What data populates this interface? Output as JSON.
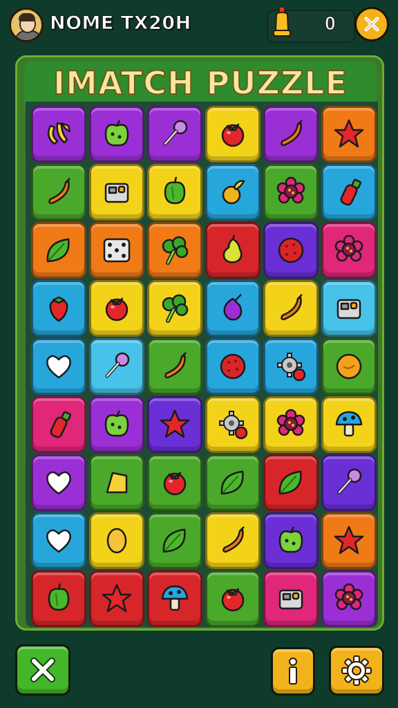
{
  "player": {
    "name": "NOME TX20H"
  },
  "score": {
    "value": "0"
  },
  "title": "IMATCH PUZZLE",
  "colors": {
    "purple": "#9b2fd6",
    "green": "#4aa82a",
    "yellow": "#f3d21a",
    "orange": "#f07a16",
    "red": "#d7262a",
    "blue": "#27a6dc",
    "pink": "#e0277a",
    "violet": "#6b2fd6",
    "lightblue": "#47c2e8"
  },
  "grid": [
    [
      {
        "c": "purple",
        "i": "banana-icon"
      },
      {
        "c": "purple",
        "i": "apple-icon"
      },
      {
        "c": "purple",
        "i": "lollipop-icon"
      },
      {
        "c": "yellow",
        "i": "tomato-icon"
      },
      {
        "c": "purple",
        "i": "pepper-icon"
      },
      {
        "c": "orange",
        "i": "star-icon"
      }
    ],
    [
      {
        "c": "green",
        "i": "pepper-icon"
      },
      {
        "c": "yellow",
        "i": "box-icon"
      },
      {
        "c": "yellow",
        "i": "bellpepper-icon"
      },
      {
        "c": "blue",
        "i": "fruit-icon"
      },
      {
        "c": "green",
        "i": "flower-icon"
      },
      {
        "c": "blue",
        "i": "bottle-icon"
      }
    ],
    [
      {
        "c": "orange",
        "i": "leaf-icon"
      },
      {
        "c": "orange",
        "i": "dice-icon"
      },
      {
        "c": "orange",
        "i": "broccoli-icon"
      },
      {
        "c": "red",
        "i": "pear-icon"
      },
      {
        "c": "violet",
        "i": "ball-icon"
      },
      {
        "c": "pink",
        "i": "flower-icon"
      }
    ],
    [
      {
        "c": "blue",
        "i": "strawberry-icon"
      },
      {
        "c": "yellow",
        "i": "tomato-icon"
      },
      {
        "c": "yellow",
        "i": "broccoli-icon"
      },
      {
        "c": "blue",
        "i": "onion-icon"
      },
      {
        "c": "yellow",
        "i": "pepper-icon"
      },
      {
        "c": "lightblue",
        "i": "box-icon"
      }
    ],
    [
      {
        "c": "blue",
        "i": "heart-icon"
      },
      {
        "c": "lightblue",
        "i": "lollipop-icon"
      },
      {
        "c": "green",
        "i": "pepper-icon"
      },
      {
        "c": "blue",
        "i": "ball-icon"
      },
      {
        "c": "blue",
        "i": "gear-icon"
      },
      {
        "c": "green",
        "i": "orange-icon"
      }
    ],
    [
      {
        "c": "pink",
        "i": "bottle-icon"
      },
      {
        "c": "purple",
        "i": "apple-icon"
      },
      {
        "c": "violet",
        "i": "star-icon"
      },
      {
        "c": "yellow",
        "i": "gear-icon"
      },
      {
        "c": "yellow",
        "i": "flower-icon"
      },
      {
        "c": "yellow",
        "i": "mushroom-icon"
      }
    ],
    [
      {
        "c": "purple",
        "i": "heart-icon"
      },
      {
        "c": "green",
        "i": "cheese-icon"
      },
      {
        "c": "green",
        "i": "tomato-icon"
      },
      {
        "c": "green",
        "i": "leaf-icon"
      },
      {
        "c": "red",
        "i": "leaf-icon"
      },
      {
        "c": "violet",
        "i": "lollipop-icon"
      }
    ],
    [
      {
        "c": "blue",
        "i": "heart-icon"
      },
      {
        "c": "yellow",
        "i": "egg-icon"
      },
      {
        "c": "green",
        "i": "leaf-icon"
      },
      {
        "c": "yellow",
        "i": "pepper-icon"
      },
      {
        "c": "violet",
        "i": "apple-icon"
      },
      {
        "c": "orange",
        "i": "star-icon"
      }
    ],
    [
      {
        "c": "red",
        "i": "bellpepper-icon"
      },
      {
        "c": "red",
        "i": "star-icon"
      },
      {
        "c": "red",
        "i": "mushroom-icon"
      },
      {
        "c": "green",
        "i": "tomato-icon"
      },
      {
        "c": "pink",
        "i": "box-icon"
      },
      {
        "c": "purple",
        "i": "flower-icon"
      }
    ]
  ]
}
